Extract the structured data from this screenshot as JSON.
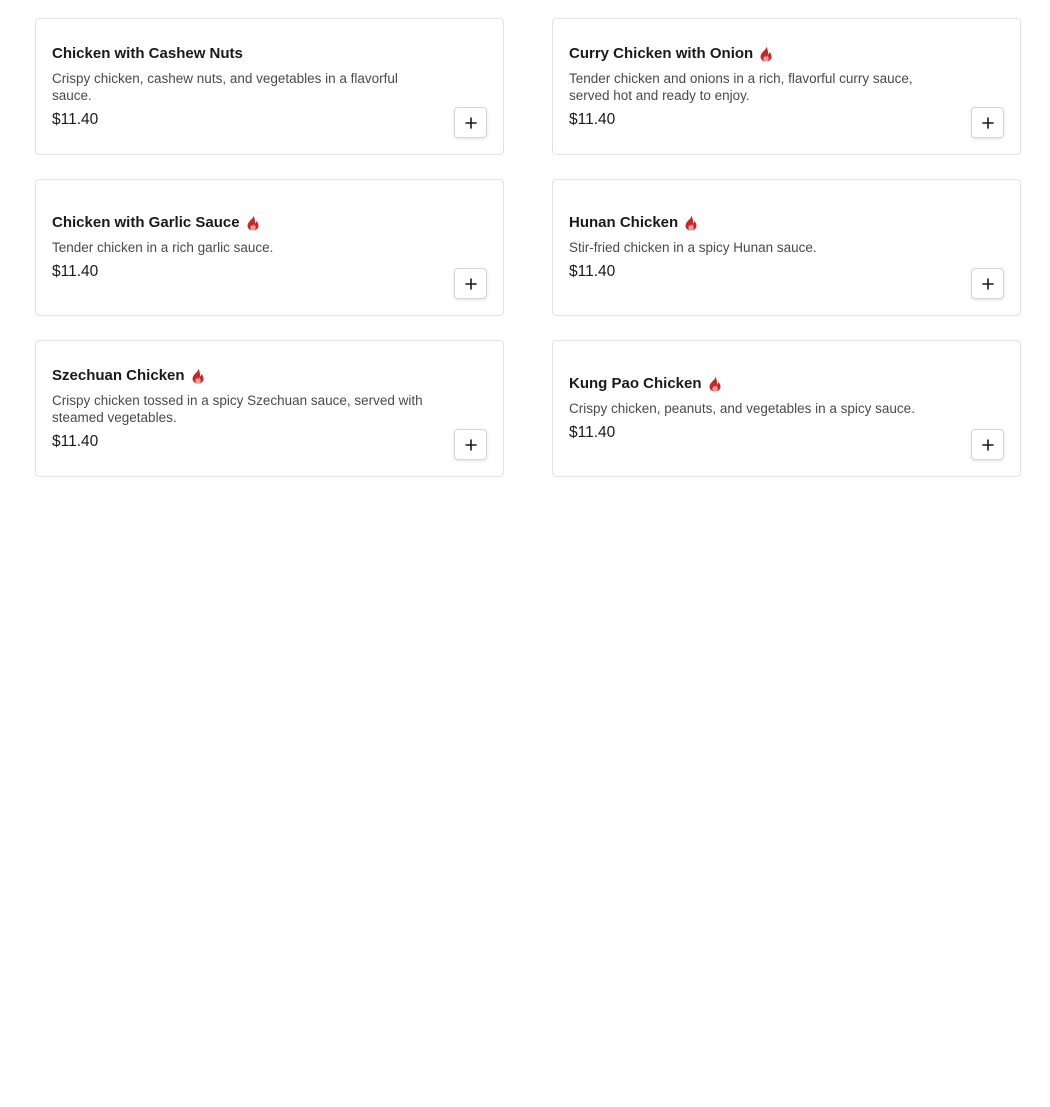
{
  "colors": {
    "spicy_icon": "#c62828",
    "border": "#e2e2e2",
    "text": "#1a1a1a",
    "muted_text": "#4a4a4a"
  },
  "menu_items": [
    {
      "name": "Chicken with Cashew Nuts",
      "spicy": false,
      "description": "Crispy chicken, cashew nuts, and vegetables in a flavorful sauce.",
      "price": "$11.40",
      "add_icon": "plus-icon"
    },
    {
      "name": "Curry Chicken with Onion",
      "spicy": true,
      "description": "Tender chicken and onions in a rich, flavorful curry sauce, served hot and ready to enjoy.",
      "price": "$11.40",
      "add_icon": "plus-icon"
    },
    {
      "name": "Chicken with Garlic Sauce",
      "spicy": true,
      "description": "Tender chicken in a rich garlic sauce.",
      "price": "$11.40",
      "add_icon": "plus-icon"
    },
    {
      "name": "Hunan Chicken",
      "spicy": true,
      "description": "Stir-fried chicken in a spicy Hunan sauce.",
      "price": "$11.40",
      "add_icon": "plus-icon"
    },
    {
      "name": "Szechuan Chicken",
      "spicy": true,
      "description": "Crispy chicken tossed in a spicy Szechuan sauce, served with steamed vegetables.",
      "price": "$11.40",
      "add_icon": "plus-icon"
    },
    {
      "name": "Kung Pao Chicken",
      "spicy": true,
      "description": "Crispy chicken, peanuts, and vegetables in a spicy sauce.",
      "price": "$11.40",
      "add_icon": "plus-icon"
    }
  ]
}
